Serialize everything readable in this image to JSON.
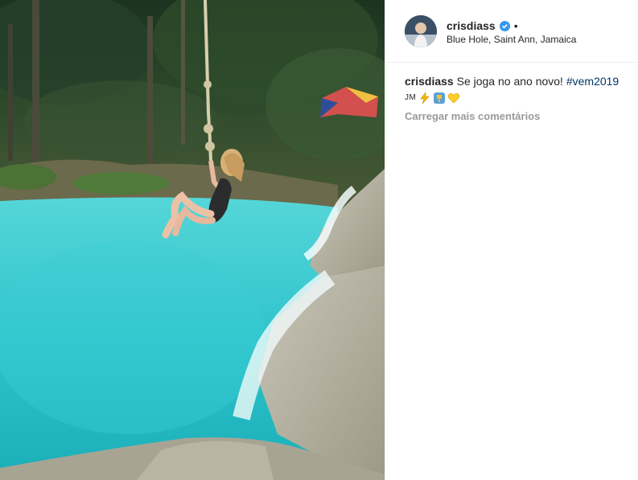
{
  "post": {
    "image_alt": "Woman swinging on a rope over turquoise water at Blue Hole",
    "colors": {
      "water": "#3fc9cc",
      "verified_blue": "#3897f0",
      "hashtag": "#003569",
      "muted": "#999999"
    }
  },
  "header": {
    "username": "crisdiass",
    "verified_icon": "verified-badge-icon",
    "separator": "•",
    "location": "Blue Hole, Saint Ann, Jamaica"
  },
  "caption": {
    "username": "crisdiass",
    "text": "Se joga no ano novo!",
    "hashtag": "#vem2019",
    "initials": "JM",
    "emojis": [
      "lightning-icon",
      "trophy-icon",
      "yellow-heart-icon"
    ]
  },
  "comments": {
    "load_more_label": "Carregar mais comentários"
  }
}
